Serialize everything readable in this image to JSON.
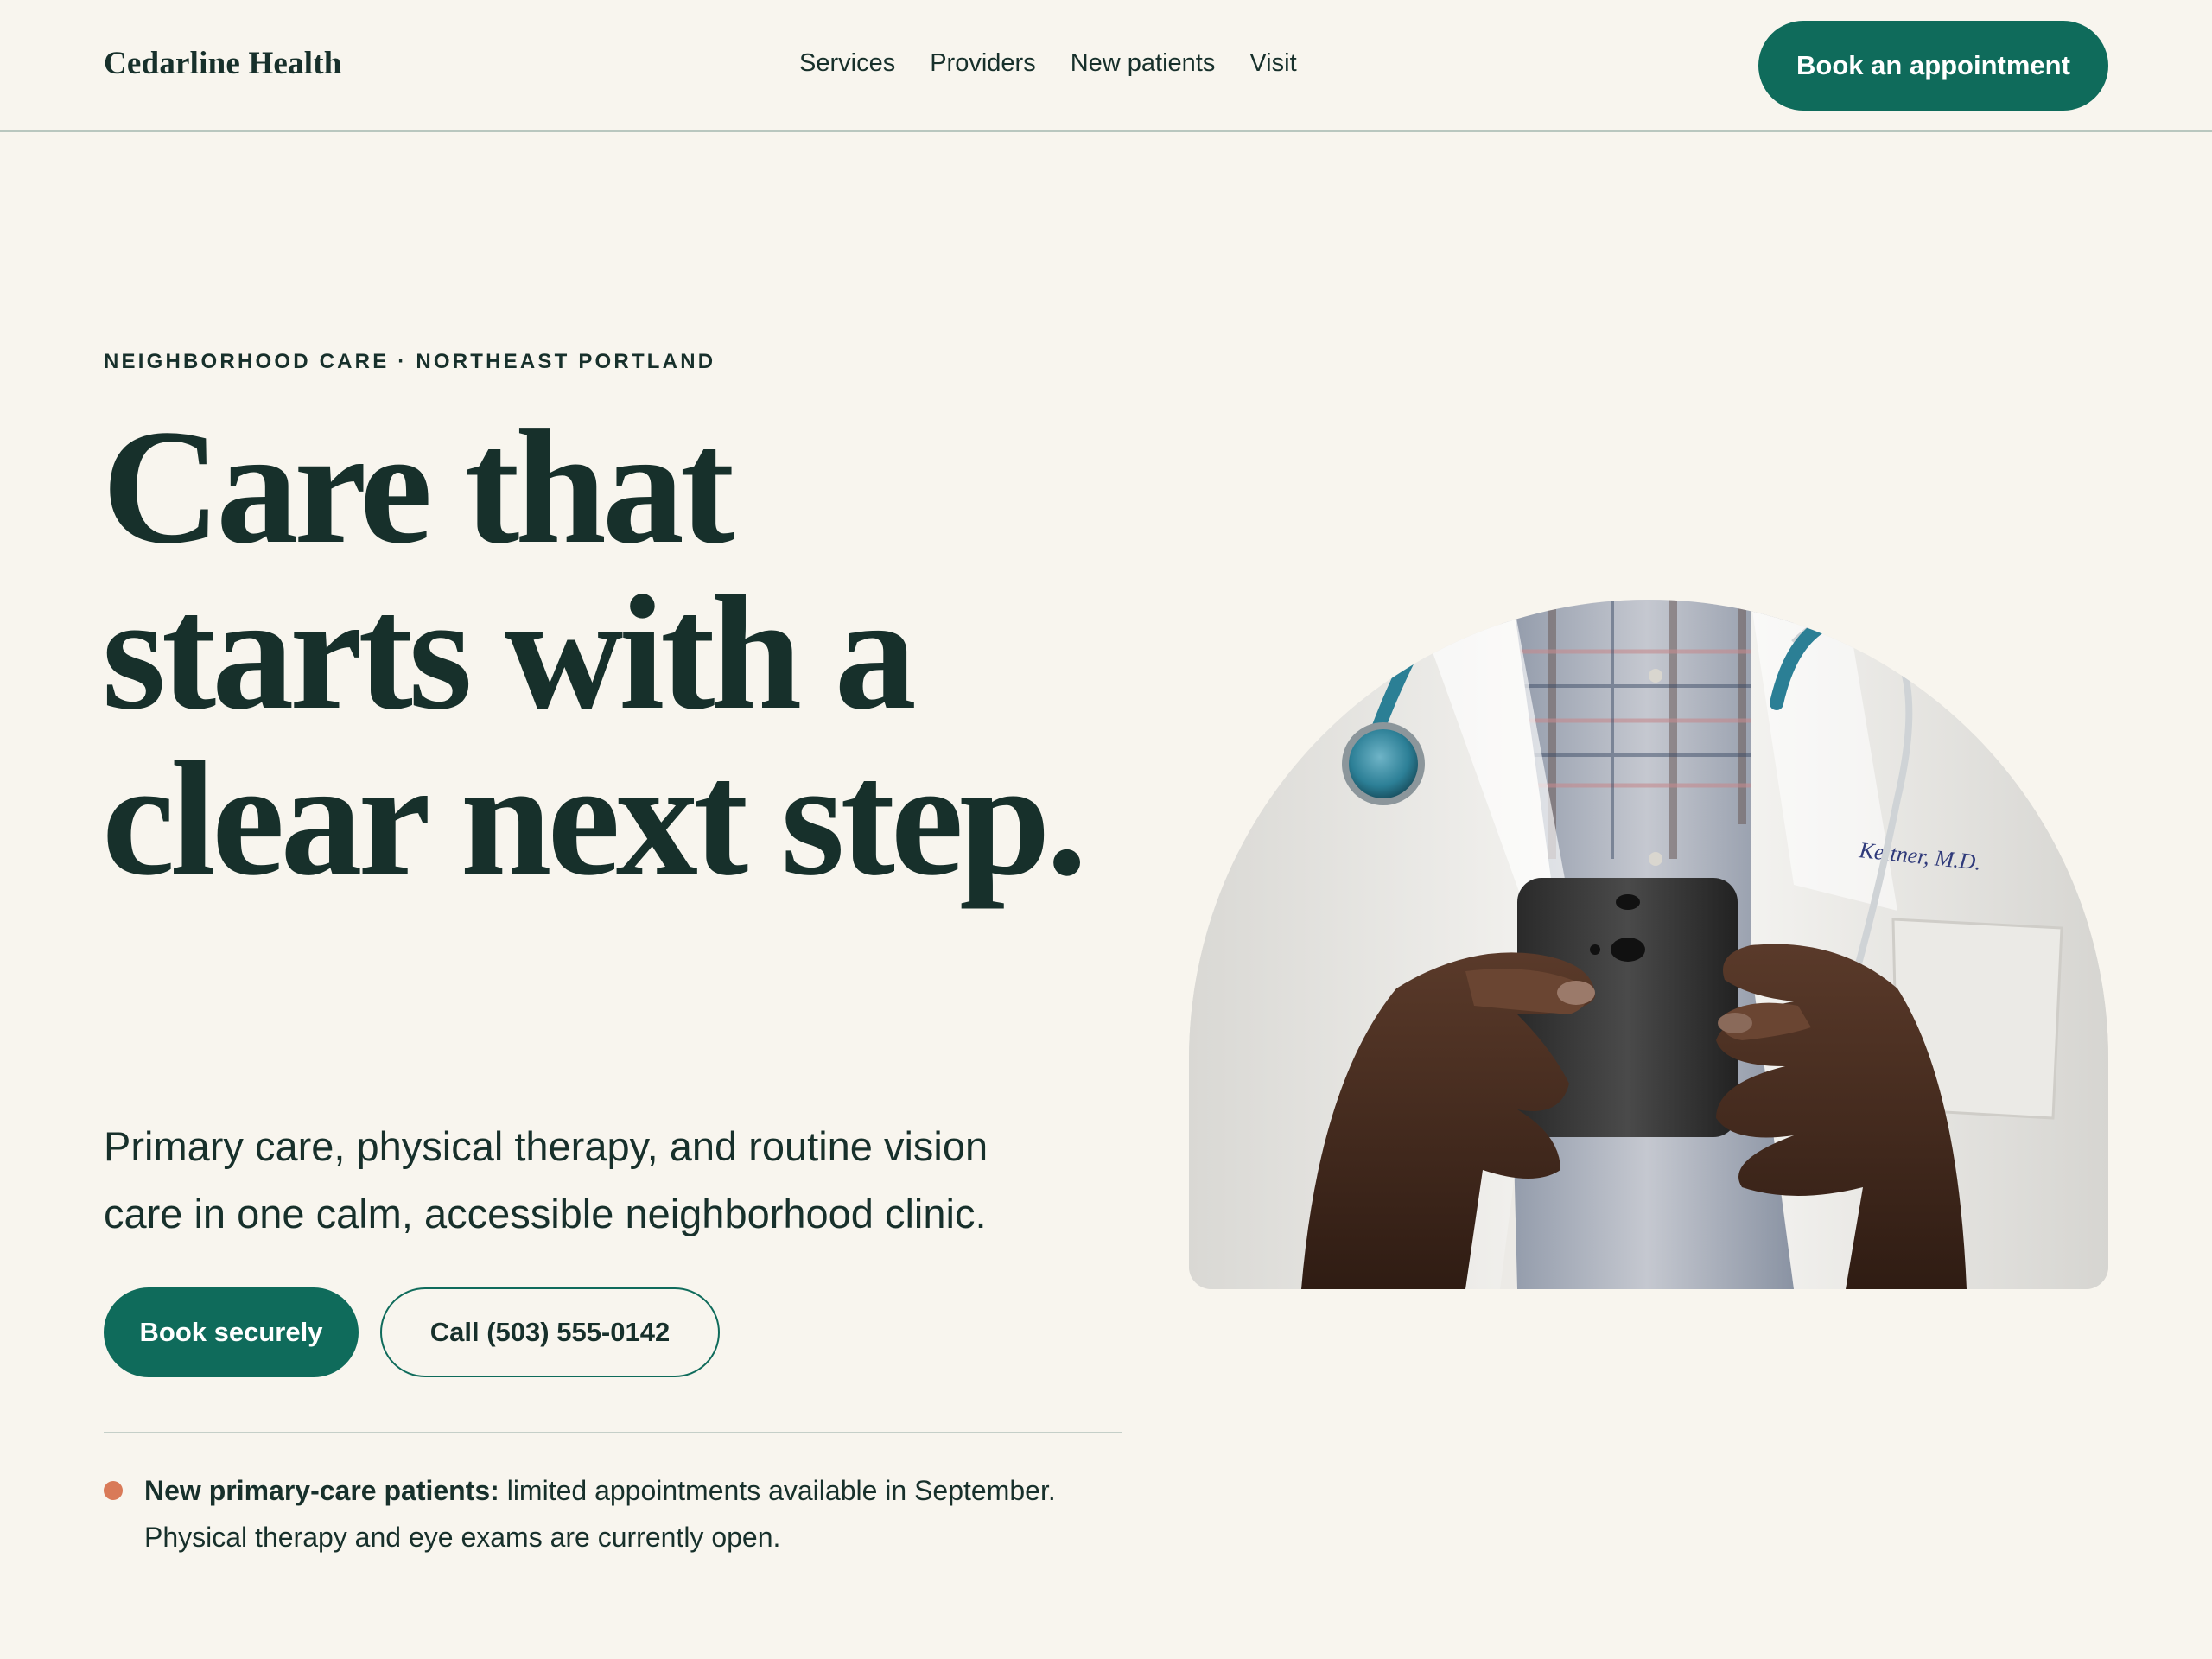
{
  "header": {
    "brand": "Cedarline Health",
    "nav": [
      "Services",
      "Providers",
      "New patients",
      "Visit"
    ],
    "cta": "Book an appointment"
  },
  "hero": {
    "eyebrow": "NEIGHBORHOOD CARE · NORTHEAST PORTLAND",
    "headline": "Care that starts with a clear next step.",
    "subtitle": "Primary care, physical therapy, and routine vision care in one calm, accessible neighborhood clinic.",
    "primary_button": "Book securely",
    "secondary_button": "Call (503) 555-0142",
    "notice_label": "New primary-care patients:",
    "notice_text": " limited appointments available in September. Physical therapy and eye exams are currently open.",
    "image": "doctor-holding-smartphone-photo",
    "coat_embroidery": "Keltner, M.D."
  },
  "colors": {
    "background": "#f8f5ee",
    "ink": "#17302b",
    "accent": "#0f6b5b",
    "notice_dot": "#d97a58"
  }
}
